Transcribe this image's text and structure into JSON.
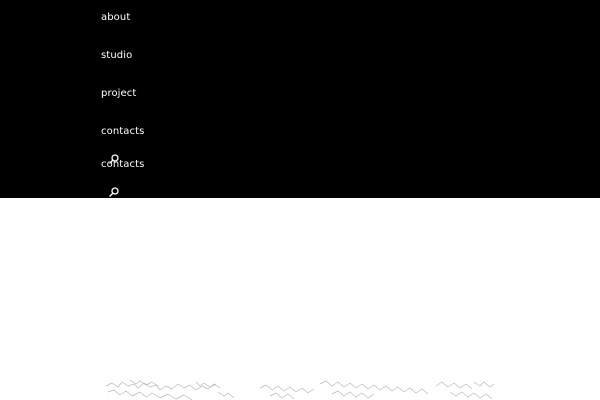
{
  "nav": {
    "items": [
      {
        "label": "about"
      },
      {
        "label": "studio"
      },
      {
        "label": "project"
      },
      {
        "label": "contacts"
      }
    ],
    "duplicate_label": "contacts"
  },
  "search": {
    "icon": "search-icon"
  },
  "colors": {
    "nav_background": "#000000",
    "nav_text": "#ffffff",
    "page_background": "#ffffff",
    "map_line": "#b8b8b8"
  }
}
